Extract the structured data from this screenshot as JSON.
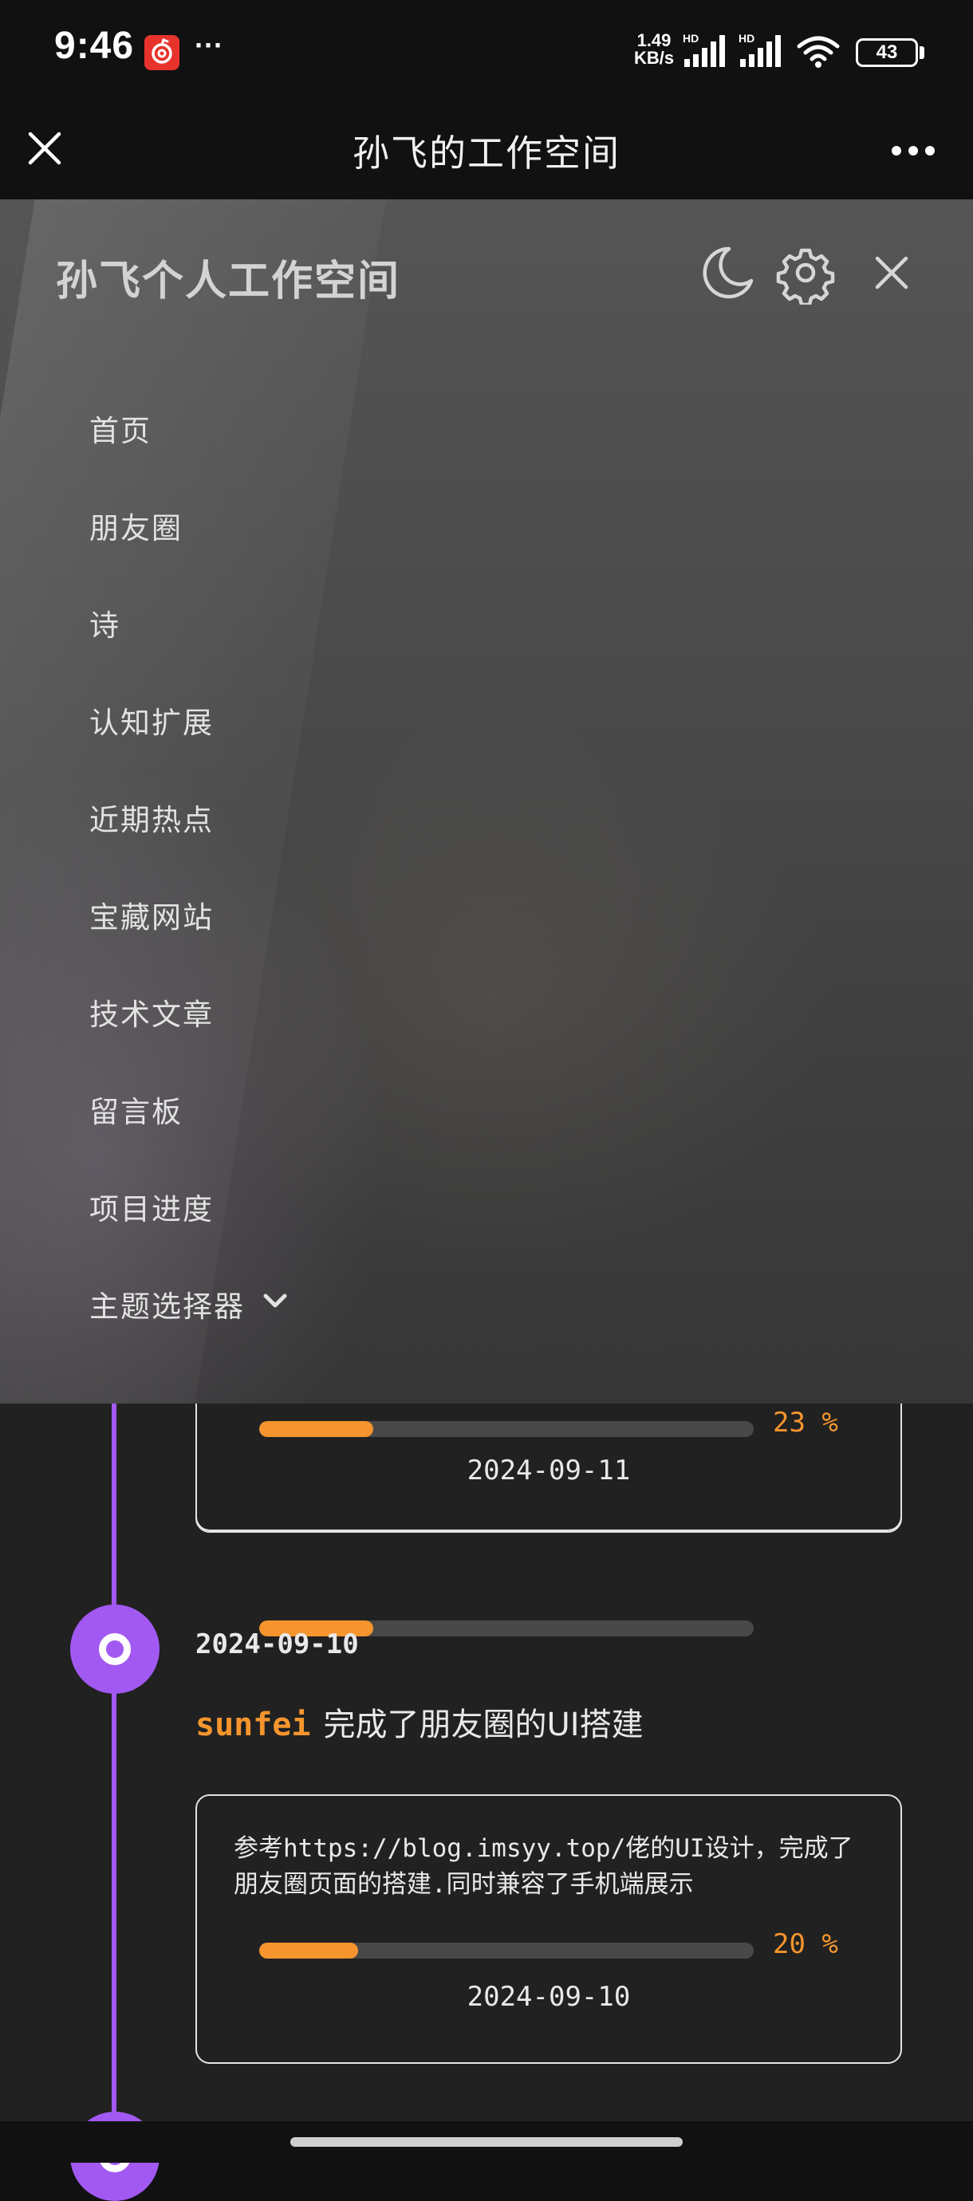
{
  "status_bar": {
    "time": "9:46",
    "dots": "···",
    "net_speed_value": "1.49",
    "net_speed_unit": "KB/s",
    "hd_1": "HD",
    "hd_2": "HD",
    "battery": "43"
  },
  "title_bar": {
    "title": "孙飞的工作空间"
  },
  "drawer": {
    "title": "孙飞个人工作空间",
    "menu": [
      {
        "label": "首页"
      },
      {
        "label": "朋友圈"
      },
      {
        "label": "诗"
      },
      {
        "label": "认知扩展"
      },
      {
        "label": "近期热点"
      },
      {
        "label": "宝藏网站"
      },
      {
        "label": "技术文章"
      },
      {
        "label": "留言板"
      },
      {
        "label": "项目进度"
      },
      {
        "label": "主题选择器"
      }
    ]
  },
  "timeline": {
    "partial_card": {
      "progress": 23,
      "progress_label": "23 %",
      "date": "2024-09-11"
    },
    "entry": {
      "date": "2024-09-10",
      "user": "sunfei",
      "action": "完成了朋友圈的UI搭建",
      "description": "参考https://blog.imsyy.top/佬的UI设计，完成了朋友圈页面的搭建.同时兼容了手机端展示",
      "progress": 20,
      "progress_label": "20 %",
      "card_date": "2024-09-10"
    }
  },
  "colors": {
    "accent_purple": "#a259f2",
    "accent_orange": "#f6952d",
    "page_background": "#212121"
  }
}
